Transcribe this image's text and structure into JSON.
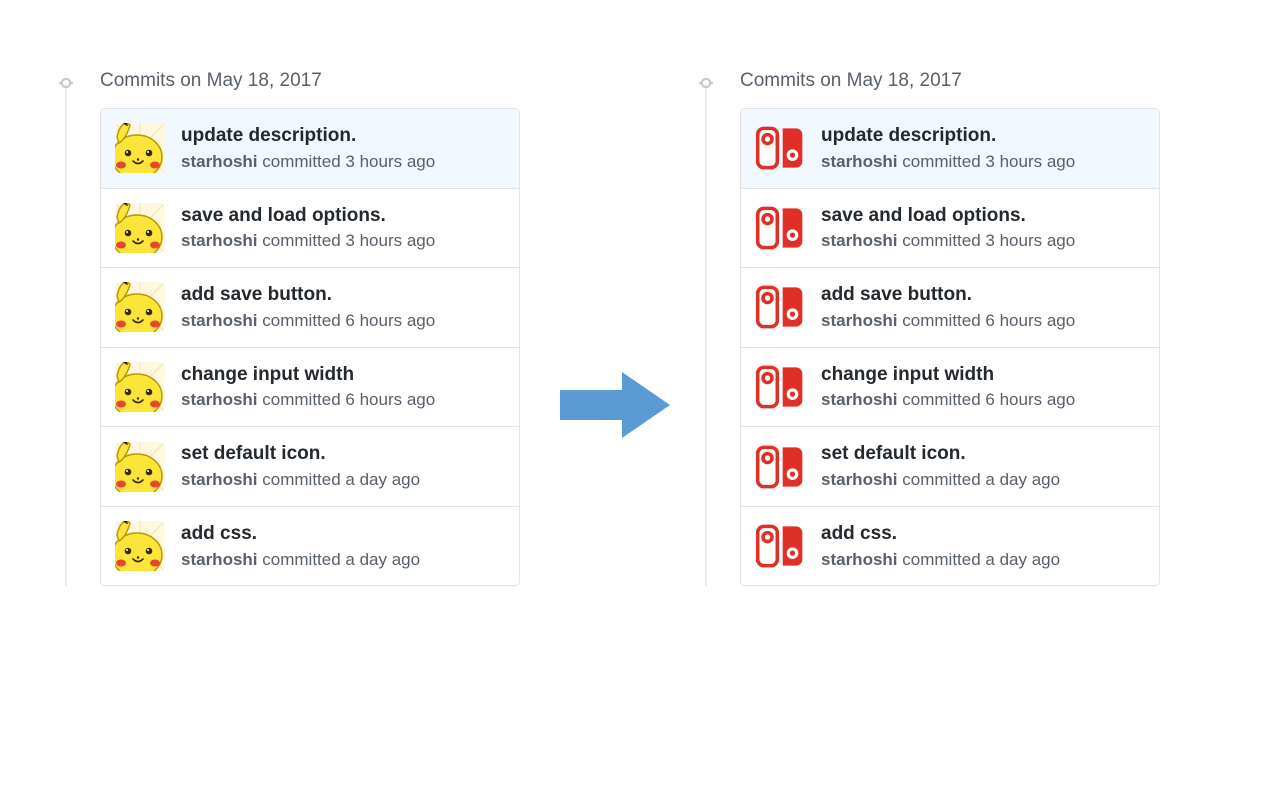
{
  "left": {
    "header": "Commits on May 18, 2017",
    "avatar": "pikachu",
    "commits": [
      {
        "title": "update description.",
        "author": "starhoshi",
        "action": "committed 3 hours ago",
        "highlight": true
      },
      {
        "title": "save and load options.",
        "author": "starhoshi",
        "action": "committed 3 hours ago",
        "highlight": false
      },
      {
        "title": "add save button.",
        "author": "starhoshi",
        "action": "committed 6 hours ago",
        "highlight": false
      },
      {
        "title": "change input width",
        "author": "starhoshi",
        "action": "committed 6 hours ago",
        "highlight": false
      },
      {
        "title": "set default icon.",
        "author": "starhoshi",
        "action": "committed a day ago",
        "highlight": false
      },
      {
        "title": "add css.",
        "author": "starhoshi",
        "action": "committed a day ago",
        "highlight": false
      }
    ]
  },
  "right": {
    "header": "Commits on May 18, 2017",
    "avatar": "switch",
    "commits": [
      {
        "title": "update description.",
        "author": "starhoshi",
        "action": "committed 3 hours ago",
        "highlight": true
      },
      {
        "title": "save and load options.",
        "author": "starhoshi",
        "action": "committed 3 hours ago",
        "highlight": false
      },
      {
        "title": "add save button.",
        "author": "starhoshi",
        "action": "committed 6 hours ago",
        "highlight": false
      },
      {
        "title": "change input width",
        "author": "starhoshi",
        "action": "committed 6 hours ago",
        "highlight": false
      },
      {
        "title": "set default icon.",
        "author": "starhoshi",
        "action": "committed a day ago",
        "highlight": false
      },
      {
        "title": "add css.",
        "author": "starhoshi",
        "action": "committed a day ago",
        "highlight": false
      }
    ]
  },
  "colors": {
    "arrow": "#5b9bd5",
    "switch": "#e02f26"
  }
}
